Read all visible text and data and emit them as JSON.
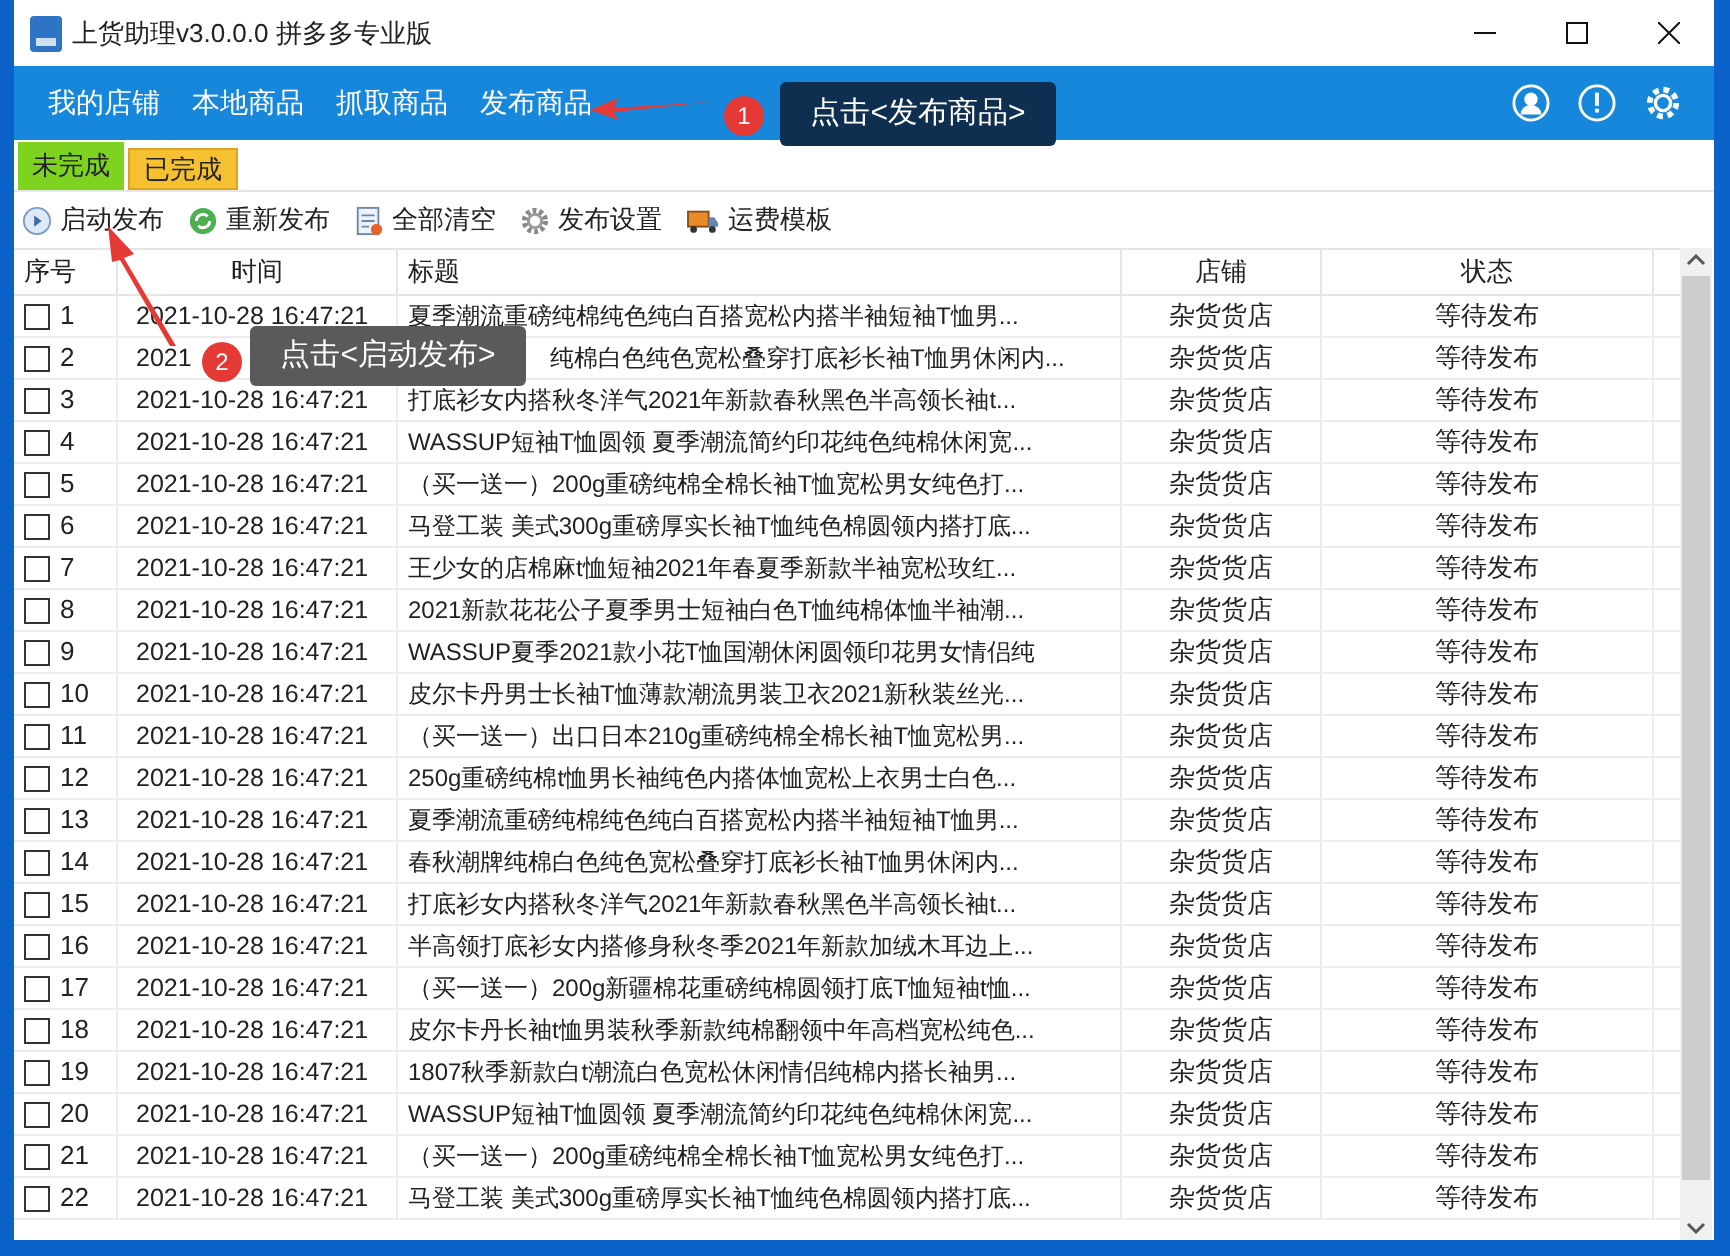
{
  "window": {
    "title": "上货助理v3.0.0.0 拼多多专业版"
  },
  "nav": {
    "items": [
      "我的店铺",
      "本地商品",
      "抓取商品",
      "发布商品"
    ]
  },
  "tabs": [
    {
      "label": "未完成",
      "selected": true,
      "color": "#7ed321"
    },
    {
      "label": "已完成",
      "selected": false,
      "color": "#f5c131"
    }
  ],
  "toolbar": [
    {
      "kind": "play",
      "label": "启动发布"
    },
    {
      "kind": "refresh",
      "label": "重新发布"
    },
    {
      "kind": "clear",
      "label": "全部清空"
    },
    {
      "kind": "gear",
      "label": "发布设置"
    },
    {
      "kind": "truck",
      "label": "运费模板"
    }
  ],
  "table": {
    "columns": [
      "序号",
      "时间",
      "标题",
      "店铺",
      "状态"
    ],
    "rows": [
      {
        "checked": false,
        "no": "1",
        "time": "2021-10-28 16:47:21",
        "title": "夏季潮流重磅纯棉纯色纯白百搭宽松内搭半袖短袖T恤男...",
        "shop": "杂货货店",
        "status": "等待发布"
      },
      {
        "checked": false,
        "kind": "covered",
        "no": "2",
        "time": "2021",
        "title": "纯棉白色纯色宽松叠穿打底衫长袖T恤男休闲内...",
        "shop": "杂货货店",
        "status": "等待发布"
      },
      {
        "checked": false,
        "no": "3",
        "time": "2021-10-28 16:47:21",
        "title": "打底衫女内搭秋冬洋气2021年新款春秋黑色半高领长袖t...",
        "shop": "杂货货店",
        "status": "等待发布"
      },
      {
        "checked": false,
        "no": "4",
        "time": "2021-10-28 16:47:21",
        "title": "WASSUP短袖T恤圆领 夏季潮流简约印花纯色纯棉休闲宽...",
        "shop": "杂货货店",
        "status": "等待发布"
      },
      {
        "checked": false,
        "no": "5",
        "time": "2021-10-28 16:47:21",
        "title": "（买一送一）200g重磅纯棉全棉长袖T恤宽松男女纯色打...",
        "shop": "杂货货店",
        "status": "等待发布"
      },
      {
        "checked": false,
        "no": "6",
        "time": "2021-10-28 16:47:21",
        "title": "马登工装 美式300g重磅厚实长袖T恤纯色棉圆领内搭打底...",
        "shop": "杂货货店",
        "status": "等待发布"
      },
      {
        "checked": false,
        "no": "7",
        "time": "2021-10-28 16:47:21",
        "title": "王少女的店棉麻t恤短袖2021年春夏季新款半袖宽松玫红...",
        "shop": "杂货货店",
        "status": "等待发布"
      },
      {
        "checked": false,
        "no": "8",
        "time": "2021-10-28 16:47:21",
        "title": "2021新款花花公子夏季男士短袖白色T恤纯棉体恤半袖潮...",
        "shop": "杂货货店",
        "status": "等待发布"
      },
      {
        "checked": false,
        "no": "9",
        "time": "2021-10-28 16:47:21",
        "title": "WASSUP夏季2021款小花T恤国潮休闲圆领印花男女情侣纯",
        "shop": "杂货货店",
        "status": "等待发布"
      },
      {
        "checked": false,
        "no": "10",
        "time": "2021-10-28 16:47:21",
        "title": "皮尔卡丹男士长袖T恤薄款潮流男装卫衣2021新秋装丝光...",
        "shop": "杂货货店",
        "status": "等待发布"
      },
      {
        "checked": false,
        "no": "11",
        "time": "2021-10-28 16:47:21",
        "title": "（买一送一）出口日本210g重磅纯棉全棉长袖T恤宽松男...",
        "shop": "杂货货店",
        "status": "等待发布"
      },
      {
        "checked": false,
        "no": "12",
        "time": "2021-10-28 16:47:21",
        "title": "250g重磅纯棉t恤男长袖纯色内搭体恤宽松上衣男士白色...",
        "shop": "杂货货店",
        "status": "等待发布"
      },
      {
        "checked": false,
        "no": "13",
        "time": "2021-10-28 16:47:21",
        "title": "夏季潮流重磅纯棉纯色纯白百搭宽松内搭半袖短袖T恤男...",
        "shop": "杂货货店",
        "status": "等待发布"
      },
      {
        "checked": false,
        "no": "14",
        "time": "2021-10-28 16:47:21",
        "title": "春秋潮牌纯棉白色纯色宽松叠穿打底衫长袖T恤男休闲内...",
        "shop": "杂货货店",
        "status": "等待发布"
      },
      {
        "checked": false,
        "no": "15",
        "time": "2021-10-28 16:47:21",
        "title": "打底衫女内搭秋冬洋气2021年新款春秋黑色半高领长袖t...",
        "shop": "杂货货店",
        "status": "等待发布"
      },
      {
        "checked": false,
        "no": "16",
        "time": "2021-10-28 16:47:21",
        "title": "半高领打底衫女内搭修身秋冬季2021年新款加绒木耳边上...",
        "shop": "杂货货店",
        "status": "等待发布"
      },
      {
        "checked": false,
        "no": "17",
        "time": "2021-10-28 16:47:21",
        "title": "（买一送一）200g新疆棉花重磅纯棉圆领打底T恤短袖t恤...",
        "shop": "杂货货店",
        "status": "等待发布"
      },
      {
        "checked": false,
        "no": "18",
        "time": "2021-10-28 16:47:21",
        "title": "皮尔卡丹长袖t恤男装秋季新款纯棉翻领中年高档宽松纯色...",
        "shop": "杂货货店",
        "status": "等待发布"
      },
      {
        "checked": false,
        "no": "19",
        "time": "2021-10-28 16:47:21",
        "title": "1807秋季新款白t潮流白色宽松休闲情侣纯棉内搭长袖男...",
        "shop": "杂货货店",
        "status": "等待发布"
      },
      {
        "checked": false,
        "no": "20",
        "time": "2021-10-28 16:47:21",
        "title": "WASSUP短袖T恤圆领 夏季潮流简约印花纯色纯棉休闲宽...",
        "shop": "杂货货店",
        "status": "等待发布"
      },
      {
        "checked": false,
        "no": "21",
        "time": "2021-10-28 16:47:21",
        "title": "（买一送一）200g重磅纯棉全棉长袖T恤宽松男女纯色打...",
        "shop": "杂货货店",
        "status": "等待发布"
      },
      {
        "checked": false,
        "no": "22",
        "time": "2021-10-28 16:47:21",
        "title": "马登工装 美式300g重磅厚实长袖T恤纯色棉圆领内搭打底...",
        "shop": "杂货货店",
        "status": "等待发布"
      }
    ]
  },
  "annotations": [
    {
      "number": "1",
      "text": "点击<发布商品>"
    },
    {
      "number": "2",
      "text": "点击<启动发布>"
    }
  ]
}
